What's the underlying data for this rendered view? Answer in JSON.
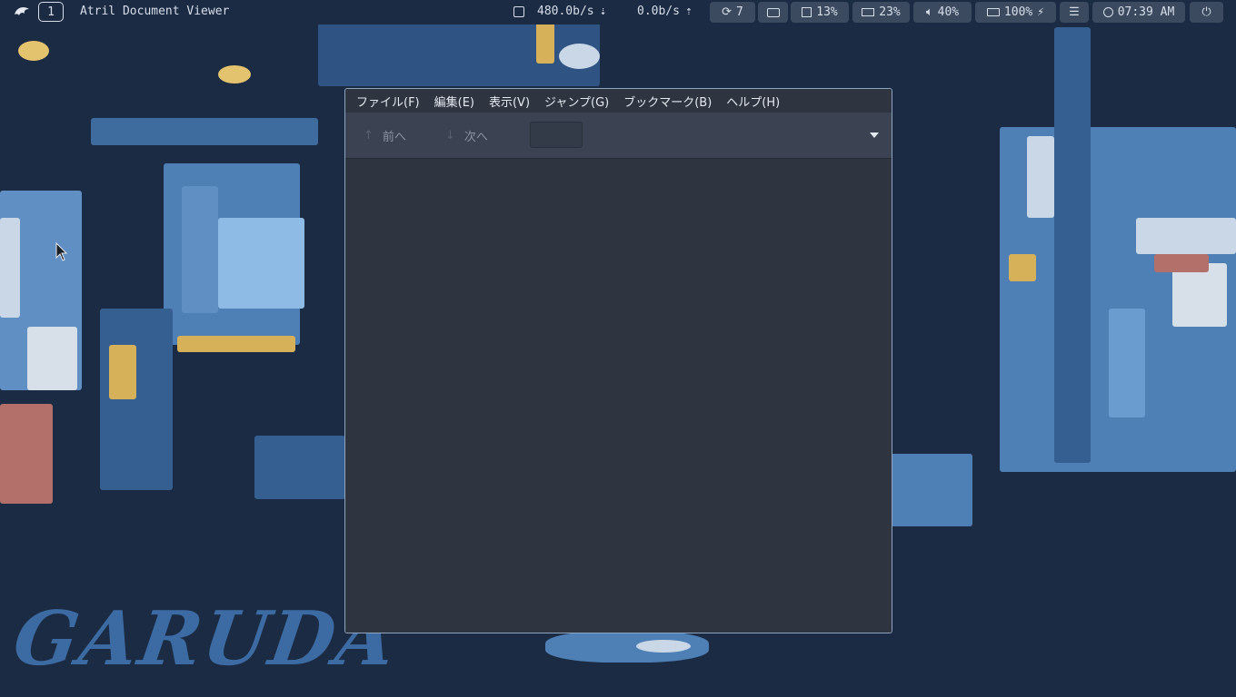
{
  "topbar": {
    "workspace": "1",
    "window_title": "Atril Document Viewer",
    "net_down": "480.0b/s",
    "net_up": "0.0b/s",
    "updates": "7",
    "cpu": "13%",
    "memory": "23%",
    "volume": "40%",
    "battery": "100%",
    "clock": "07:39 AM"
  },
  "wallpaper": {
    "brand": "GARUDA"
  },
  "atril": {
    "menu": [
      "ファイル(F)",
      "編集(E)",
      "表示(V)",
      "ジャンプ(G)",
      "ブックマーク(B)",
      "ヘルプ(H)"
    ],
    "toolbar": {
      "prev_label": "前へ",
      "next_label": "次へ",
      "page_value": ""
    }
  },
  "colors": {
    "bar_bg": "#1b2b44",
    "pill_bg": "#3b4a5e",
    "window_bg": "#2e3440",
    "toolbar_bg": "#3b4252",
    "accent_blue": "#6a9ccf"
  }
}
